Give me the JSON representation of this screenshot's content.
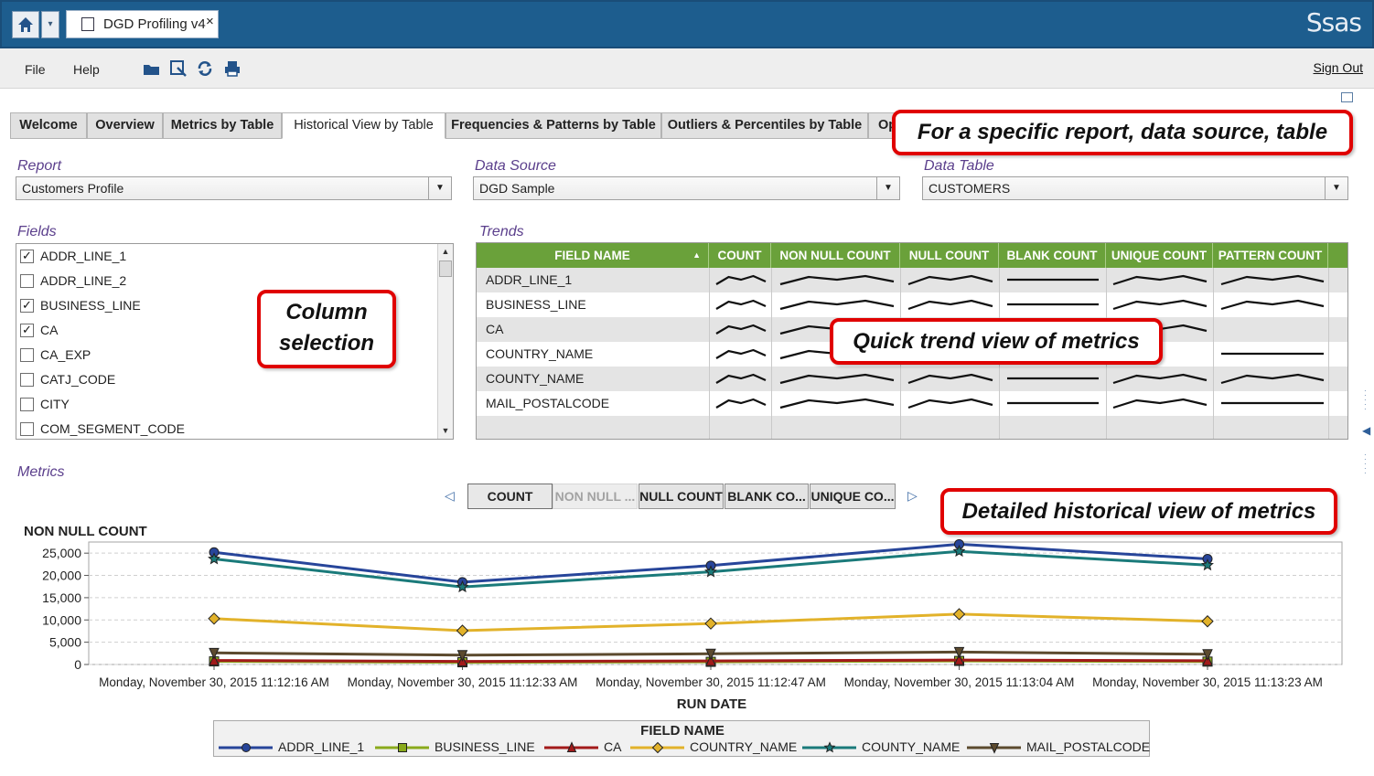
{
  "window": {
    "doc_tab_title": "DGD Profiling v4",
    "close_glyph": "×",
    "home_icon": "home-icon",
    "home_dropdown_glyph": "▾",
    "brand": "Ssas",
    "brand_color": "#1d5d8e"
  },
  "menubar": {
    "file": "File",
    "help": "Help",
    "sign_out": "Sign Out",
    "toolbar_icons": [
      "open-folder-icon",
      "export-icon",
      "refresh-icon",
      "print-icon"
    ]
  },
  "tabs": [
    {
      "label": "Welcome",
      "active": false
    },
    {
      "label": "Overview",
      "active": false
    },
    {
      "label": "Metrics by Table",
      "active": false
    },
    {
      "label": "Historical View by Table",
      "active": true
    },
    {
      "label": "Frequencies & Patterns by Table",
      "active": false
    },
    {
      "label": "Outliers & Percentiles by Table",
      "active": false
    },
    {
      "label": "Op",
      "active": false
    }
  ],
  "selectors": {
    "report": {
      "label": "Report",
      "value": "Customers Profile"
    },
    "data_source": {
      "label": "Data Source",
      "value": "DGD Sample"
    },
    "data_table": {
      "label": "Data Table",
      "value": "CUSTOMERS"
    }
  },
  "fields": {
    "label": "Fields",
    "items": [
      {
        "name": "ADDR_LINE_1",
        "checked": true
      },
      {
        "name": "ADDR_LINE_2",
        "checked": false
      },
      {
        "name": "BUSINESS_LINE",
        "checked": true
      },
      {
        "name": "CA",
        "checked": true
      },
      {
        "name": "CA_EXP",
        "checked": false
      },
      {
        "name": "CATJ_CODE",
        "checked": false
      },
      {
        "name": "CITY",
        "checked": false
      },
      {
        "name": "COM_SEGMENT_CODE",
        "checked": false
      }
    ]
  },
  "trends": {
    "label": "Trends",
    "sort_glyph": "▲",
    "columns": [
      "FIELD NAME",
      "COUNT",
      "NON NULL COUNT",
      "NULL COUNT",
      "BLANK COUNT",
      "UNIQUE COUNT",
      "PATTERN COUNT"
    ],
    "rows": [
      "ADDR_LINE_1",
      "BUSINESS_LINE",
      "CA",
      "COUNTRY_NAME",
      "COUNTY_NAME",
      "MAIL_POSTALCODE"
    ]
  },
  "metrics": {
    "label": "Metrics",
    "buttons": [
      {
        "label": "COUNT",
        "enabled": true
      },
      {
        "label": "NON NULL ...",
        "enabled": false
      },
      {
        "label": "NULL COUNT",
        "enabled": true
      },
      {
        "label": "BLANK CO...",
        "enabled": true
      },
      {
        "label": "UNIQUE CO...",
        "enabled": true
      }
    ],
    "prev_glyph": "◁",
    "next_glyph": "▷"
  },
  "annotations": {
    "top": "For a specific report, data source, table",
    "column_selection_line1": "Column",
    "column_selection_line2": "selection",
    "quick_trend": "Quick trend view of metrics",
    "detailed": "Detailed historical view of metrics"
  },
  "chart_data": {
    "type": "line",
    "title": "NON NULL COUNT",
    "xlabel": "RUN DATE",
    "ylabel": "",
    "legend_title": "FIELD NAME",
    "legend_position": "bottom",
    "ylim": [
      0,
      27500
    ],
    "yticks": [
      0,
      5000,
      10000,
      15000,
      20000,
      25000
    ],
    "ytick_labels": [
      "0",
      "5,000",
      "10,000",
      "15,000",
      "20,000",
      "25,000"
    ],
    "x": [
      "Monday, November 30, 2015 11:12:16 AM",
      "Monday, November 30, 2015 11:12:33 AM",
      "Monday, November 30, 2015 11:12:47 AM",
      "Monday, November 30, 2015 11:13:04 AM",
      "Monday, November 30, 2015 11:13:23 AM"
    ],
    "grid": true,
    "series": [
      {
        "name": "ADDR_LINE_1",
        "color": "#27459a",
        "marker": "circle",
        "values": [
          25200,
          18500,
          22200,
          27000,
          23700
        ]
      },
      {
        "name": "BUSINESS_LINE",
        "color": "#8aaa1c",
        "marker": "square",
        "values": [
          700,
          500,
          600,
          800,
          650
        ]
      },
      {
        "name": "CA",
        "color": "#a21a1a",
        "marker": "triangle",
        "values": [
          900,
          700,
          800,
          1000,
          850
        ]
      },
      {
        "name": "COUNTRY_NAME",
        "color": "#e2b22a",
        "marker": "diamond",
        "values": [
          10300,
          7600,
          9200,
          11300,
          9700
        ]
      },
      {
        "name": "COUNTY_NAME",
        "color": "#1a7a7a",
        "marker": "star",
        "values": [
          23700,
          17400,
          20800,
          25400,
          22300
        ]
      },
      {
        "name": "MAIL_POSTALCODE",
        "color": "#5c4a2e",
        "marker": "triangle-down",
        "values": [
          2600,
          2100,
          2400,
          2800,
          2300
        ]
      }
    ]
  }
}
